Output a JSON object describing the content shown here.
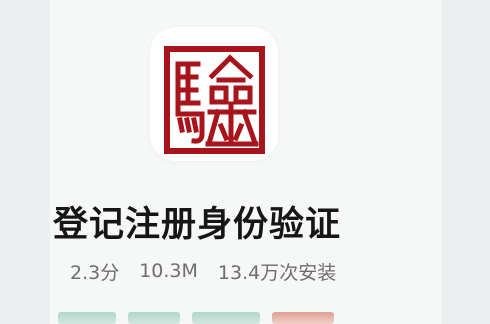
{
  "app": {
    "icon": "seal-stamp-icon",
    "seal_glyphs": "騐",
    "name": "登记注册身份验证",
    "rating": "2.3分",
    "size": "10.3M",
    "installs": "13.4万次安装"
  },
  "colors": {
    "seal_red": "#a8141b",
    "background": "#eceeef",
    "title": "#161616",
    "meta": "#6e6e6e"
  }
}
